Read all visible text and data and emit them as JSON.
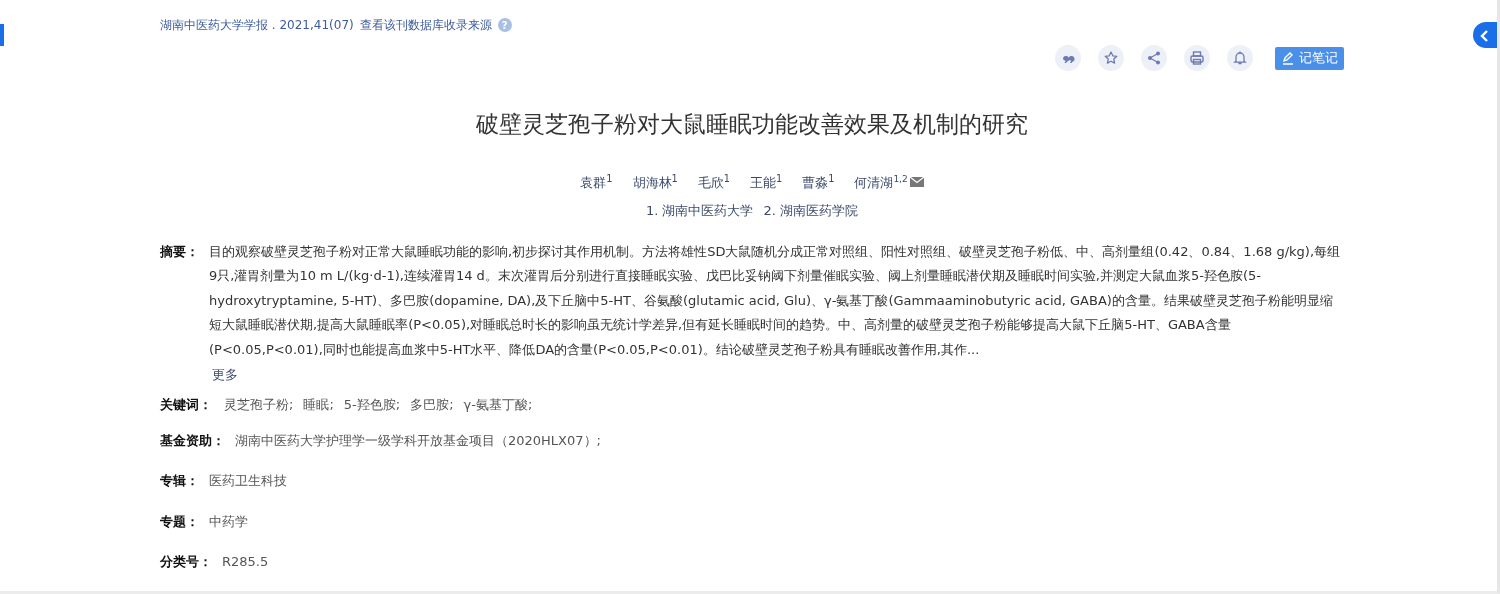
{
  "source": {
    "journal": "湖南中医药大学学报 . 2021,41(07)",
    "link": "查看该刊数据库收录来源",
    "help_icon": "?"
  },
  "tools": [
    {
      "kind": "quote"
    },
    {
      "kind": "star"
    },
    {
      "kind": "share"
    },
    {
      "kind": "print"
    },
    {
      "kind": "bell"
    }
  ],
  "note_button": "记笔记",
  "title": "破壁灵芝孢子粉对大鼠睡眠功能改善效果及机制的研究",
  "authors": [
    {
      "name": "袁群$^{1}$",
      "email": false
    },
    {
      "name": "胡海林$^{1}$",
      "email": false
    },
    {
      "name": "毛欣$^{1}$",
      "email": false
    },
    {
      "name": "王能$^{1}$",
      "email": false
    },
    {
      "name": "曹淼$^{1}$",
      "email": false
    },
    {
      "name": "何清湖$^{1,2}$",
      "email": true
    }
  ],
  "affiliations": [
    "1. 湖南中医药大学",
    "2. 湖南医药学院"
  ],
  "abstract": {
    "label": "摘要：",
    "text": "目的观察破壁灵芝孢子粉对正常大鼠睡眠功能的影响,初步探讨其作用机制。方法将雄性SD大鼠随机分成正常对照组、阳性对照组、破壁灵芝孢子粉低、中、高剂量组(0.42、0.84、1.68 g/kg),每组9只,灌胃剂量为10 m L/(kg·d-1),连续灌胃14 d。末次灌胃后分别进行直接睡眠实验、戊巴比妥钠阈下剂量催眠实验、阈上剂量睡眠潜伏期及睡眠时间实验,并测定大鼠血浆5-羟色胺(5-hydroxytryptamine, 5-HT)、多巴胺(dopamine, DA),及下丘脑中5-HT、谷氨酸(glutamic acid, Glu)、γ-氨基丁酸(Gammaaminobutyric acid, GABA)的含量。结果破壁灵芝孢子粉能明显缩短大鼠睡眠潜伏期,提高大鼠睡眠率(P<0.05),对睡眠总时长的影响虽无统计学差异,但有延长睡眠时间的趋势。中、高剂量的破壁灵芝孢子粉能够提高大鼠下丘脑5-HT、GABA含量(P<0.05,P<0.01),同时也能提高血浆中5-HT水平、降低DA的含量(P<0.05,P<0.01)。结论破壁灵芝孢子粉具有睡眠改善作用,其作...",
    "more": "更多"
  },
  "keywords": {
    "label": "关键词：",
    "items": [
      "灵芝孢子粉;",
      "睡眠;",
      "5-羟色胺;",
      "多巴胺;",
      "γ-氨基丁酸;"
    ]
  },
  "fields": [
    {
      "label": "基金资助：",
      "value": "湖南中医药大学护理学一级学科开放基金项目（2020HLX07）;"
    },
    {
      "label": "专辑：",
      "value": "医药卫生科技"
    },
    {
      "label": "专题：",
      "value": "中药学"
    },
    {
      "label": "分类号：",
      "value": "R285.5"
    }
  ]
}
